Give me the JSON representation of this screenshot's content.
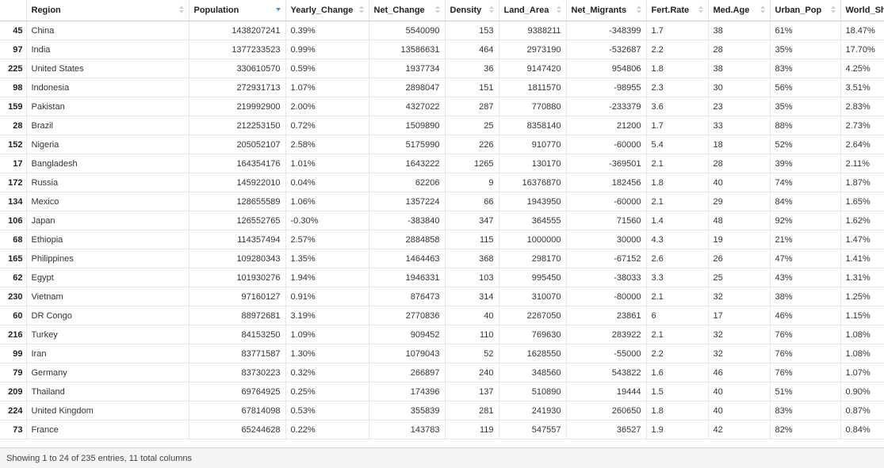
{
  "columns": [
    "",
    "Region",
    "Population",
    "Yearly_Change",
    "Net_Change",
    "Density",
    "Land_Area",
    "Net_Migrants",
    "Fert.Rate",
    "Med.Age",
    "Urban_Pop",
    "World_Share"
  ],
  "align": [
    "idx",
    "txt",
    "num",
    "txt",
    "num",
    "num",
    "num",
    "num",
    "txt",
    "txt",
    "txt",
    "txt"
  ],
  "sort_state": [
    "none",
    "none",
    "desc",
    "none",
    "none",
    "none",
    "none",
    "none",
    "none",
    "none",
    "none",
    "none"
  ],
  "rows": [
    [
      "45",
      "China",
      "1438207241",
      "0.39%",
      "5540090",
      "153",
      "9388211",
      "-348399",
      "1.7",
      "38",
      "61%",
      "18.47%"
    ],
    [
      "97",
      "India",
      "1377233523",
      "0.99%",
      "13586631",
      "464",
      "2973190",
      "-532687",
      "2.2",
      "28",
      "35%",
      "17.70%"
    ],
    [
      "225",
      "United States",
      "330610570",
      "0.59%",
      "1937734",
      "36",
      "9147420",
      "954806",
      "1.8",
      "38",
      "83%",
      "4.25%"
    ],
    [
      "98",
      "Indonesia",
      "272931713",
      "1.07%",
      "2898047",
      "151",
      "1811570",
      "-98955",
      "2.3",
      "30",
      "56%",
      "3.51%"
    ],
    [
      "159",
      "Pakistan",
      "219992900",
      "2.00%",
      "4327022",
      "287",
      "770880",
      "-233379",
      "3.6",
      "23",
      "35%",
      "2.83%"
    ],
    [
      "28",
      "Brazil",
      "212253150",
      "0.72%",
      "1509890",
      "25",
      "8358140",
      "21200",
      "1.7",
      "33",
      "88%",
      "2.73%"
    ],
    [
      "152",
      "Nigeria",
      "205052107",
      "2.58%",
      "5175990",
      "226",
      "910770",
      "-60000",
      "5.4",
      "18",
      "52%",
      "2.64%"
    ],
    [
      "17",
      "Bangladesh",
      "164354176",
      "1.01%",
      "1643222",
      "1265",
      "130170",
      "-369501",
      "2.1",
      "28",
      "39%",
      "2.11%"
    ],
    [
      "172",
      "Russia",
      "145922010",
      "0.04%",
      "62206",
      "9",
      "16376870",
      "182456",
      "1.8",
      "40",
      "74%",
      "1.87%"
    ],
    [
      "134",
      "Mexico",
      "128655589",
      "1.06%",
      "1357224",
      "66",
      "1943950",
      "-60000",
      "2.1",
      "29",
      "84%",
      "1.65%"
    ],
    [
      "106",
      "Japan",
      "126552765",
      "-0.30%",
      "-383840",
      "347",
      "364555",
      "71560",
      "1.4",
      "48",
      "92%",
      "1.62%"
    ],
    [
      "68",
      "Ethiopia",
      "114357494",
      "2.57%",
      "2884858",
      "115",
      "1000000",
      "30000",
      "4.3",
      "19",
      "21%",
      "1.47%"
    ],
    [
      "165",
      "Philippines",
      "109280343",
      "1.35%",
      "1464463",
      "368",
      "298170",
      "-67152",
      "2.6",
      "26",
      "47%",
      "1.41%"
    ],
    [
      "62",
      "Egypt",
      "101930276",
      "1.94%",
      "1946331",
      "103",
      "995450",
      "-38033",
      "3.3",
      "25",
      "43%",
      "1.31%"
    ],
    [
      "230",
      "Vietnam",
      "97160127",
      "0.91%",
      "876473",
      "314",
      "310070",
      "-80000",
      "2.1",
      "32",
      "38%",
      "1.25%"
    ],
    [
      "60",
      "DR Congo",
      "88972681",
      "3.19%",
      "2770836",
      "40",
      "2267050",
      "23861",
      "6",
      "17",
      "46%",
      "1.15%"
    ],
    [
      "216",
      "Turkey",
      "84153250",
      "1.09%",
      "909452",
      "110",
      "769630",
      "283922",
      "2.1",
      "32",
      "76%",
      "1.08%"
    ],
    [
      "99",
      "Iran",
      "83771587",
      "1.30%",
      "1079043",
      "52",
      "1628550",
      "-55000",
      "2.2",
      "32",
      "76%",
      "1.08%"
    ],
    [
      "79",
      "Germany",
      "83730223",
      "0.32%",
      "266897",
      "240",
      "348560",
      "543822",
      "1.6",
      "46",
      "76%",
      "1.07%"
    ],
    [
      "209",
      "Thailand",
      "69764925",
      "0.25%",
      "174396",
      "137",
      "510890",
      "19444",
      "1.5",
      "40",
      "51%",
      "0.90%"
    ],
    [
      "224",
      "United Kingdom",
      "67814098",
      "0.53%",
      "355839",
      "281",
      "241930",
      "260650",
      "1.8",
      "40",
      "83%",
      "0.87%"
    ],
    [
      "73",
      "France",
      "65244628",
      "0.22%",
      "143783",
      "119",
      "547557",
      "36527",
      "1.9",
      "42",
      "82%",
      "0.84%"
    ]
  ],
  "footer": {
    "info": "Showing 1 to 24 of 235 entries, 11 total columns"
  }
}
